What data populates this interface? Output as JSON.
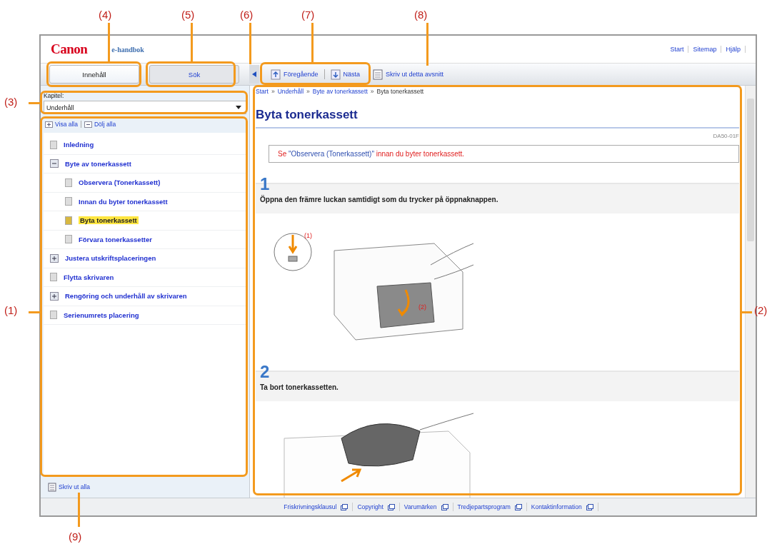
{
  "header": {
    "logo": "Canon",
    "subtitle": "e-handbok",
    "links": [
      "Start",
      "Sitemap",
      "Hjälp"
    ]
  },
  "tabs": [
    {
      "label": "Innehåll",
      "selected": true
    },
    {
      "label": "Sök",
      "selected": false
    }
  ],
  "toolbar": {
    "previous": "Föregående",
    "next": "Nästa",
    "print": "Skriv ut detta avsnitt"
  },
  "sidebar": {
    "chapter_label": "Kapitel:",
    "chapter_value": "Underhåll",
    "show_all": "Visa alla",
    "hide_all": "Dölj alla",
    "tree": [
      {
        "label": "Inledning",
        "kind": "page",
        "selected": false
      },
      {
        "label": "Byte av tonerkassett",
        "kind": "folder",
        "expanded": true,
        "selected": false,
        "children": [
          {
            "label": "Observera (Tonerkassett)",
            "kind": "page",
            "selected": false
          },
          {
            "label": "Innan du byter tonerkassett",
            "kind": "page",
            "selected": false
          },
          {
            "label": "Byta tonerkassett",
            "kind": "page",
            "selected": true
          },
          {
            "label": "Förvara tonerkassetter",
            "kind": "page",
            "selected": false
          }
        ]
      },
      {
        "label": "Justera utskriftsplaceringen",
        "kind": "folder",
        "expanded": false,
        "selected": false
      },
      {
        "label": "Flytta skrivaren",
        "kind": "page",
        "selected": false
      },
      {
        "label": "Rengöring och underhåll av skrivaren",
        "kind": "folder",
        "expanded": false,
        "selected": false
      },
      {
        "label": "Serienumrets placering",
        "kind": "page",
        "selected": false
      }
    ],
    "print_all": "Skriv ut alla"
  },
  "content": {
    "breadcrumb": [
      {
        "label": "Start",
        "current": false
      },
      {
        "label": "Underhåll",
        "current": false
      },
      {
        "label": "Byte av tonerkassett",
        "current": false
      },
      {
        "label": "Byta tonerkassett",
        "current": true
      }
    ],
    "separator": "»",
    "title": "Byta tonerkassett",
    "doc_id": "DA50-01F",
    "note": {
      "before": "Se ",
      "link": "\"Observera (Tonerkassett)\"",
      "after": " innan du byter tonerkassett."
    },
    "steps": [
      {
        "number": "1",
        "text": "Öppna den främre luckan samtidigt som du trycker på öppnaknappen.",
        "labels": [
          "(1)",
          "(2)"
        ]
      },
      {
        "number": "2",
        "text": "Ta bort tonerkassetten."
      }
    ]
  },
  "footer_links": [
    "Friskrivningsklausul",
    "Copyright",
    "Varumärken",
    "Tredjepartsprogram",
    "Kontaktinformation"
  ],
  "callouts": [
    "(1)",
    "(2)",
    "(3)",
    "(4)",
    "(5)",
    "(6)",
    "(7)",
    "(8)",
    "(9)"
  ]
}
